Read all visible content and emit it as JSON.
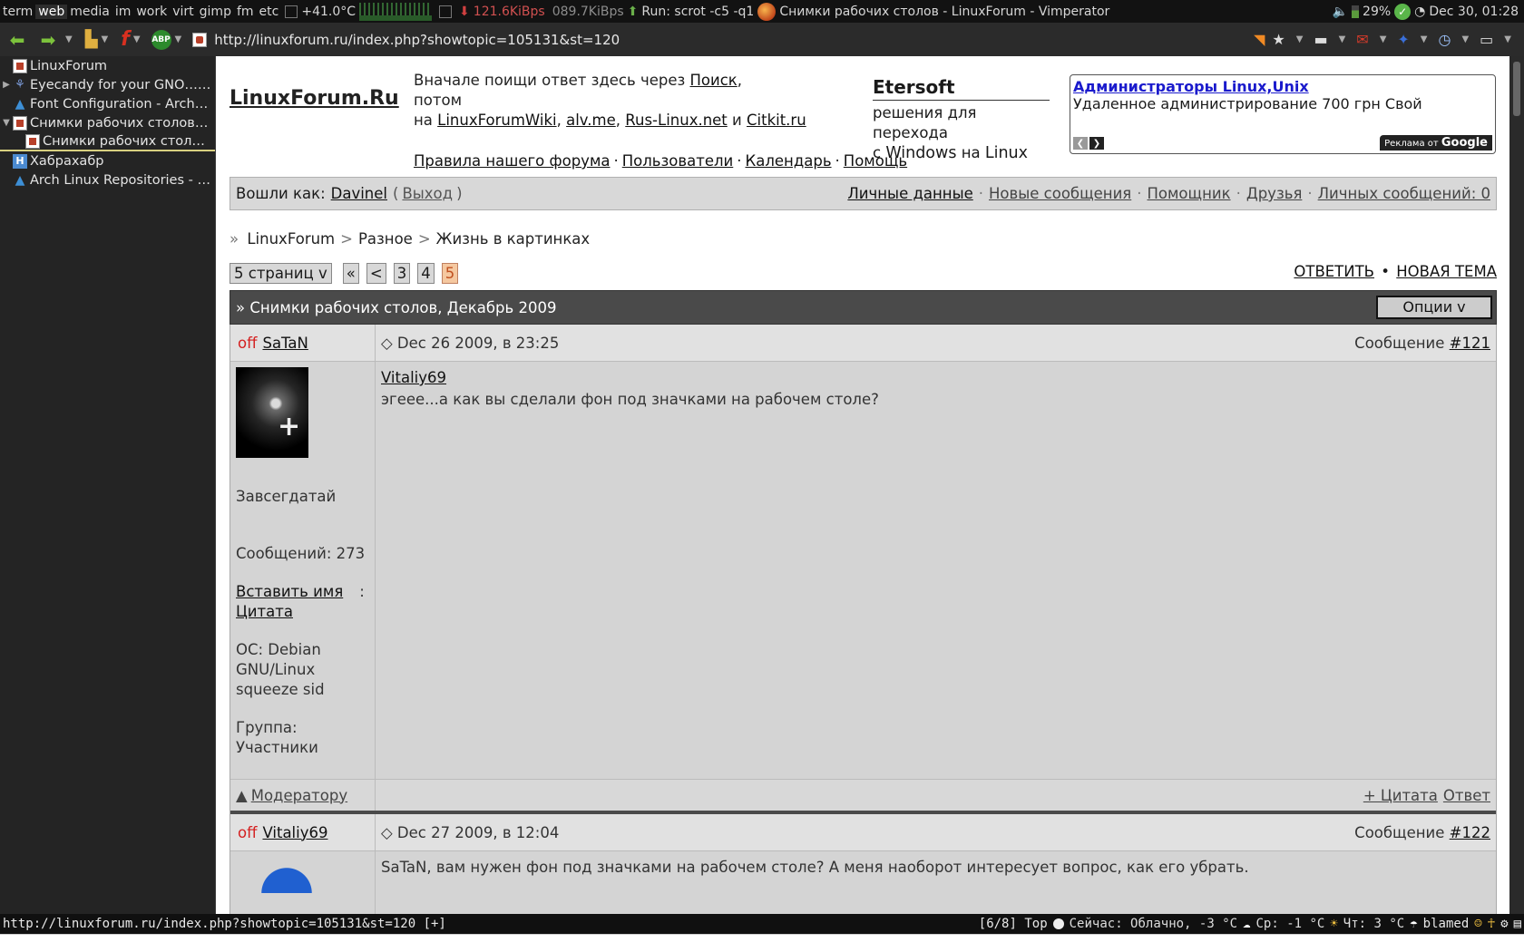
{
  "top_panel": {
    "tags": [
      "term",
      "web",
      "media",
      "im",
      "work",
      "virt",
      "gimp",
      "fm",
      "etc"
    ],
    "active_tag": "web",
    "temperature": "+41.0°C",
    "download_speed": "121.6KiBps",
    "upload_speed": "089.7KiBps",
    "run_label": "Run: scrot -c5 -q1",
    "window_title": "Снимки рабочих столов - LinuxForum - Vimperator",
    "battery": "29%",
    "clock": "Dec 30, 01:28"
  },
  "nav": {
    "url": "http://linuxforum.ru/index.php?showtopic=105131&st=120",
    "abp_label": "ABP"
  },
  "sidebar": {
    "items": [
      {
        "label": "LinuxForum",
        "icon": "forum-favicon",
        "indent": 0,
        "twisty": ""
      },
      {
        "label": "Eyecandy for your GNO… (1)",
        "icon": "gnome-icon",
        "indent": 0,
        "twisty": "▶"
      },
      {
        "label": "Font Configuration - Arch…",
        "icon": "arch-icon",
        "indent": 0,
        "twisty": ""
      },
      {
        "label": "Снимки рабочих столов …",
        "icon": "forum-favicon",
        "indent": 0,
        "twisty": "▼"
      },
      {
        "label": "Снимки рабочих столо…",
        "icon": "forum-favicon",
        "indent": 1,
        "twisty": ""
      },
      {
        "label": "Хабрахабр",
        "icon": "habr-icon",
        "indent": 0,
        "twisty": ""
      },
      {
        "label": "Arch Linux Repositories - p…",
        "icon": "arch-icon",
        "indent": 0,
        "twisty": ""
      }
    ]
  },
  "header": {
    "logo": "LinuxForum.Ru",
    "intro_line1": "Вначале поищи ответ здесь через ",
    "search_link": "Поиск",
    "intro_line2": "потом",
    "intro_on": "на ",
    "wiki_link": "LinuxForumWiki",
    "alvme_link": "alv.me",
    "ruslinux_link": "Rus-Linux.net",
    "and_word": " и ",
    "citkit_link": "Citkit.ru",
    "eter_title": "Etersoft",
    "eter_sub1": "решения для перехода",
    "eter_sub2_pre": "с ",
    "eter_windows": "Windows",
    "eter_on": " на ",
    "eter_linux": "Linux",
    "ad_title": "Администраторы Linux,Unix",
    "ad_text": "Удаленное администрирование 700 грн Свой",
    "ad_google": "Реклама от ",
    "ad_google_brand": "Google",
    "links": [
      "Правила нашего форума",
      "Пользователи",
      "Календарь",
      "Помощь"
    ]
  },
  "userbar": {
    "logged_as": "Вошли как: ",
    "user": "Davinel",
    "logout": "Выход",
    "links": [
      "Личные данные",
      "Новые сообщения",
      "Помощник",
      "Друзья",
      "Личных сообщений: 0"
    ]
  },
  "breadcrumb": {
    "prefix": "»",
    "items": [
      "LinuxForum",
      "Разное",
      "Жизнь в картинках"
    ]
  },
  "pager": {
    "pages_label": "5 страниц v",
    "first": "«",
    "prev": "<",
    "pages": [
      "3",
      "4",
      "5"
    ],
    "current": "5"
  },
  "actions": {
    "reply": "ОТВЕТИТЬ",
    "bullet": "•",
    "new_topic": "НОВАЯ ТЕМА"
  },
  "topic": {
    "title": "» Снимки рабочих столов, Декабрь 2009",
    "options": "Опции v"
  },
  "posts": [
    {
      "status": "off",
      "author": "SaTaN",
      "date": "◇ Dec 26 2009, в 23:25",
      "num_label": "Сообщение ",
      "num_link": "#121",
      "rank": "Завсегдатай",
      "posts_count": "Сообщений: 273",
      "insert_name": "Вставить имя",
      "colon": ":",
      "quote": "Цитата",
      "os": "ОС: Debian GNU/Linux squeeze sid",
      "group": "Группа: Участники",
      "quote_author": "Vitaliy69",
      "text": "эгеее...а как вы сделали фон под значками на рабочем столе?",
      "moderator": "Модератору",
      "mod_prefix": "▲",
      "plus_quote": "+ Цитата",
      "answer": "Ответ"
    },
    {
      "status": "off",
      "author": "Vitaliy69",
      "date": "◇ Dec 27 2009, в 12:04",
      "num_label": "Сообщение ",
      "num_link": "#122",
      "text": "SaTaN, вам нужен фон под значками на рабочем столе? А меня наоборот интересует вопрос, как его убрать."
    }
  ],
  "status_bar": {
    "url": "http://linuxforum.ru/index.php?showtopic=105131&st=120 [+]",
    "position": "[6/8] Top",
    "weather_now": "Сейчас: Облачно, -3 °C",
    "weather_wed": "Ср: -1 °C",
    "weather_thu": "Чт: 3 °C",
    "blamed": "blamed"
  }
}
